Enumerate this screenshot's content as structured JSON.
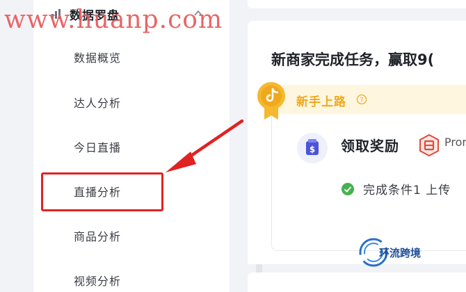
{
  "sidebar": {
    "section_title": "数据罗盘",
    "items": [
      {
        "label": "数据概览"
      },
      {
        "label": "达人分析"
      },
      {
        "label": "今日直播"
      },
      {
        "label": "直播分析"
      },
      {
        "label": "商品分析"
      },
      {
        "label": "视频分析"
      }
    ]
  },
  "main": {
    "task_title": "新商家完成任务，赢取9(",
    "banner_label": "新手上路",
    "reward_title": "领取奖励",
    "promo_text": "Pron",
    "condition_text": "完成条件1 上传"
  },
  "watermark": "www.huanp.com",
  "brand_logo_text": "环流跨境",
  "colors": {
    "highlight": "#e12222",
    "banner_text": "#f0a81d",
    "check": "#45b24c"
  }
}
